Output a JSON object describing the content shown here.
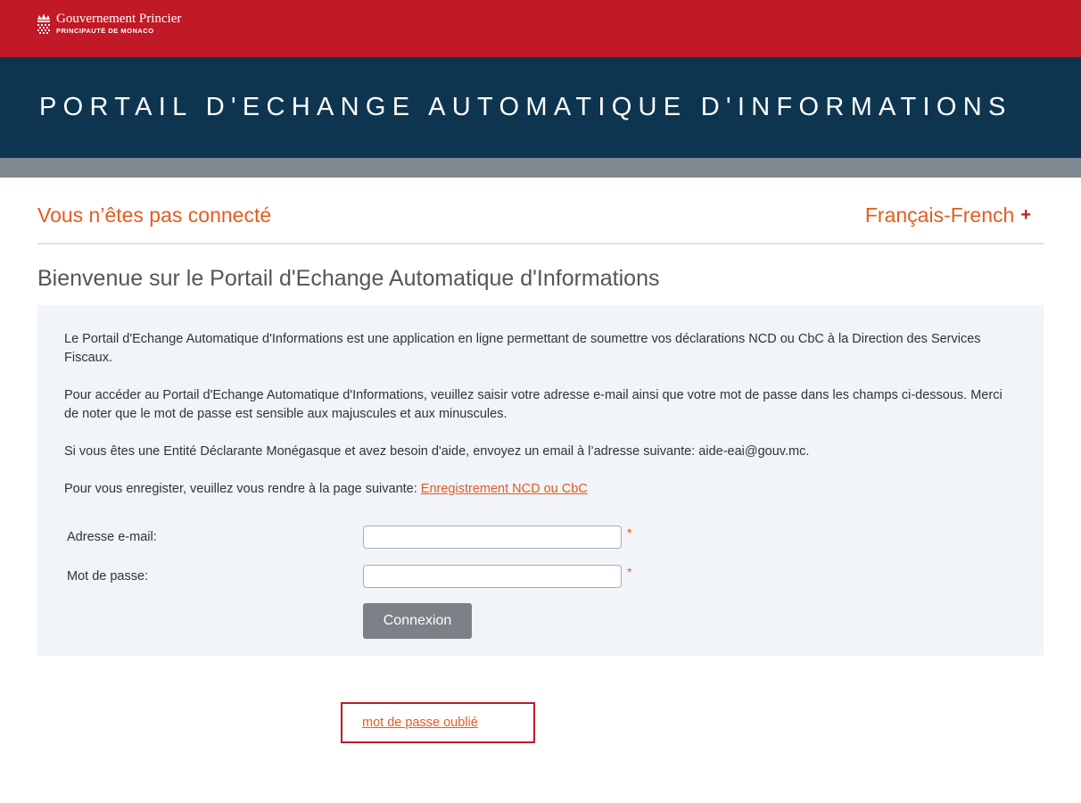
{
  "header": {
    "gov_name": "Gouvernement Princier",
    "gov_sub": "PRINCIPAUTÉ DE MONACO",
    "portal_title": "PORTAIL D'ECHANGE AUTOMATIQUE D'INFORMATIONS"
  },
  "status": {
    "not_connected": "Vous n’êtes pas connecté",
    "language": "Français-French",
    "language_plus": "+"
  },
  "welcome": "Bienvenue sur le Portail d'Echange Automatique d'Informations",
  "panel": {
    "p1": "Le Portail d'Echange Automatique d'Informations est une application en ligne permettant de soumettre vos déclarations NCD ou CbC à la Direction des Services Fiscaux.",
    "p2": "Pour accéder au Portail d'Echange Automatique d'Informations, veuillez saisir votre adresse e-mail ainsi que votre mot de passe dans les champs ci-dessous. Merci de noter que le mot de passe est sensible aux majuscules et aux minuscules.",
    "p3": "Si vous êtes une Entité Déclarante Monégasque et avez besoin d'aide, envoyez un email à l’adresse suivante: aide-eai@gouv.mc.",
    "p4_text": "Pour vous enregister, veuillez vous rendre à la page suivante: ",
    "p4_link": "Enregistrement NCD ou CbC"
  },
  "form": {
    "email_label": "Adresse e-mail:",
    "email_value": "",
    "password_label": "Mot de passe:",
    "password_value": "",
    "required_mark": "*",
    "submit_label": "Connexion",
    "forgot_label": "mot de passe oublié"
  },
  "colors": {
    "brand_red": "#c01a26",
    "navy": "#0e3550",
    "accent_orange": "#e65b1f"
  }
}
